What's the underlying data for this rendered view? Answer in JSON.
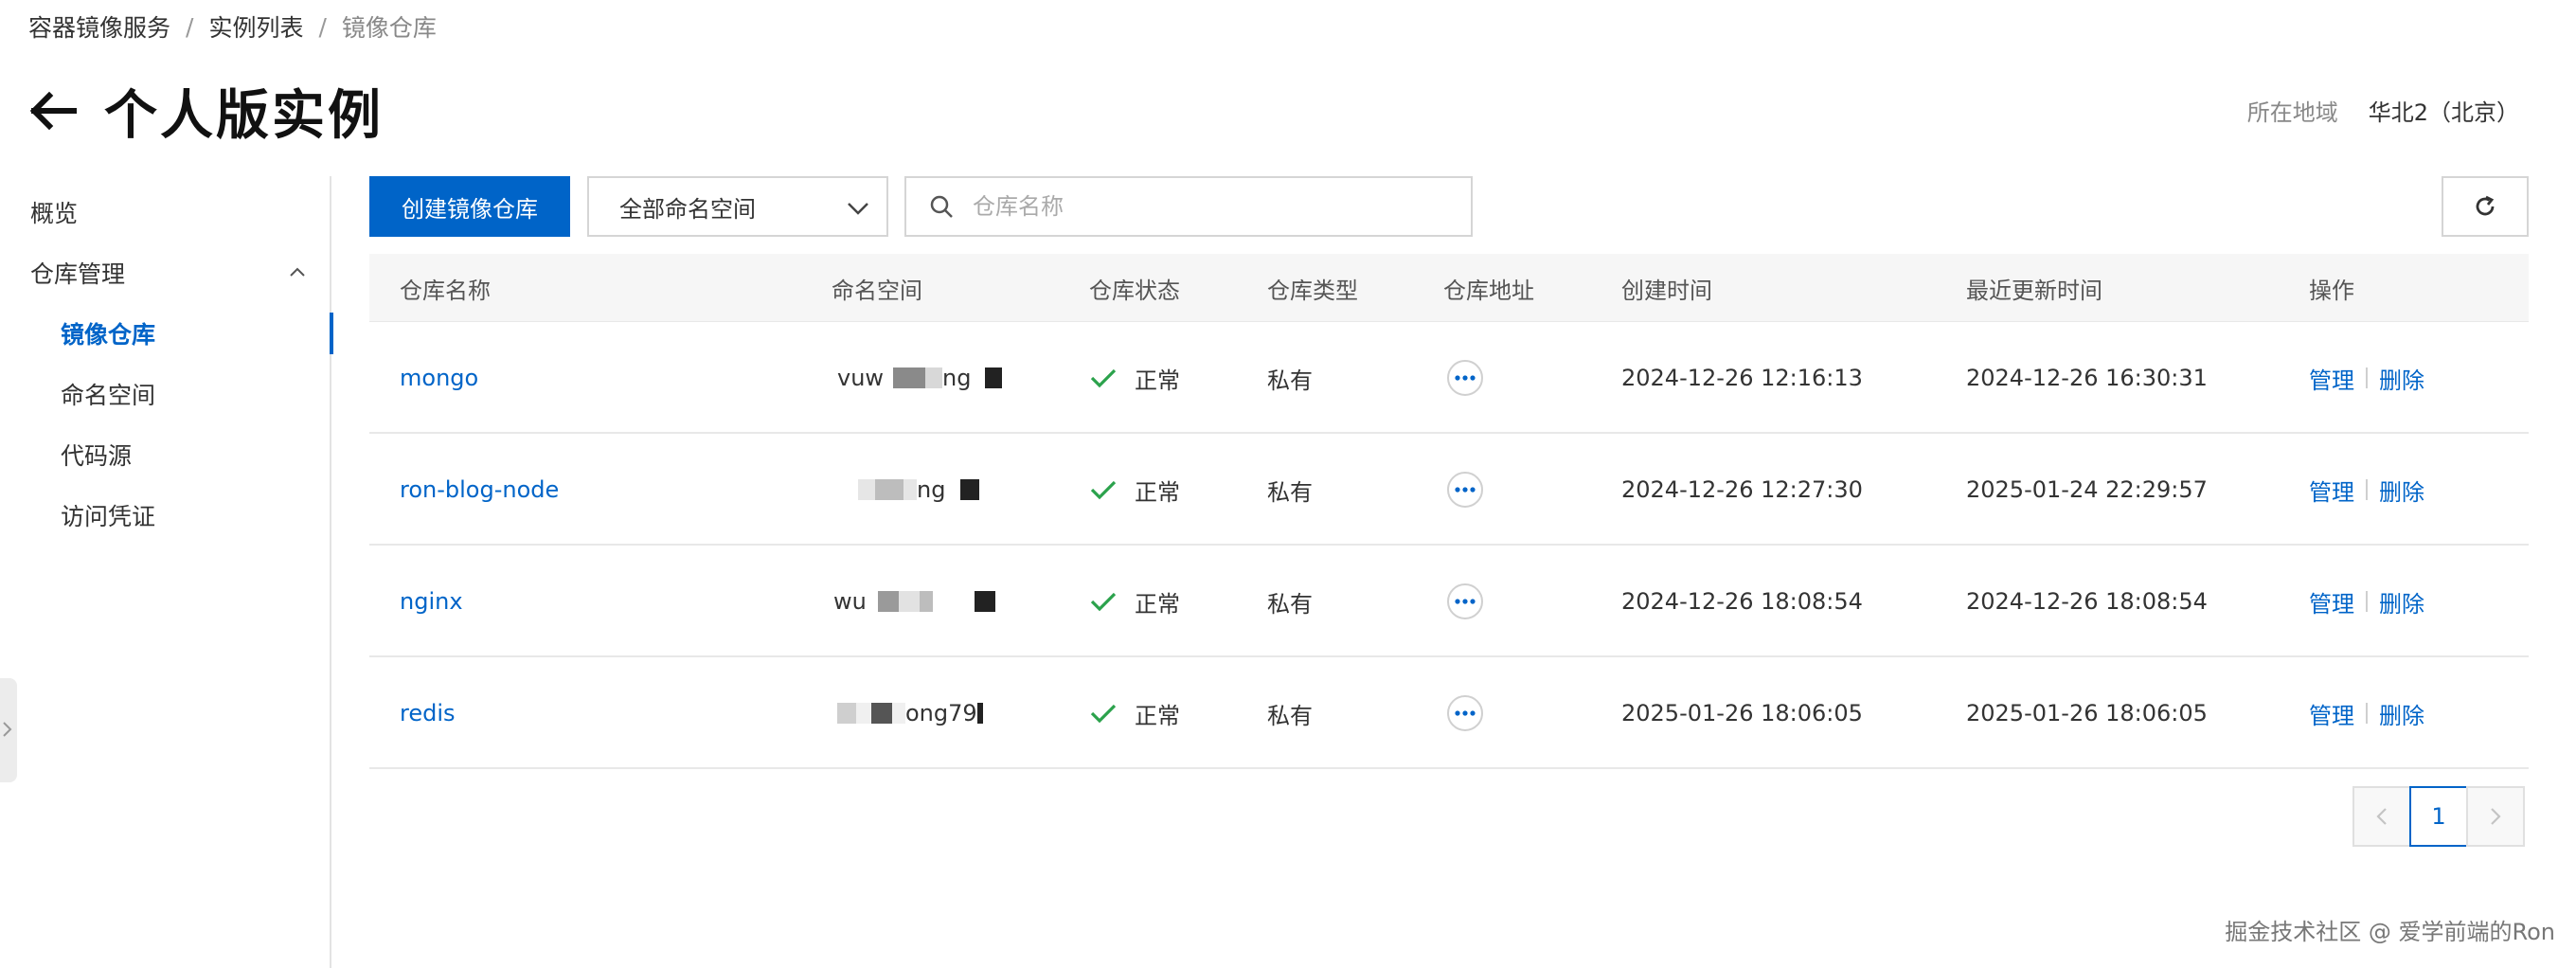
{
  "breadcrumb": {
    "items": [
      "容器镜像服务",
      "实例列表",
      "镜像仓库"
    ],
    "separator": "/"
  },
  "header": {
    "title": "个人版实例",
    "back_icon": "arrow-left-icon"
  },
  "region": {
    "label": "所在地域",
    "value": "华北2（北京）"
  },
  "sidebar": {
    "items": [
      {
        "label": "概览",
        "level": "top"
      },
      {
        "label": "仓库管理",
        "level": "top",
        "expanded": true
      },
      {
        "label": "镜像仓库",
        "level": "sub",
        "active": true
      },
      {
        "label": "命名空间",
        "level": "sub"
      },
      {
        "label": "代码源",
        "level": "sub"
      },
      {
        "label": "访问凭证",
        "level": "sub"
      }
    ]
  },
  "toolbar": {
    "create_label": "创建镜像仓库",
    "namespace_select": "全部命名空间",
    "search_placeholder": "仓库名称",
    "refresh_icon": "refresh-icon"
  },
  "table": {
    "columns": [
      "仓库名称",
      "命名空间",
      "仓库状态",
      "仓库类型",
      "仓库地址",
      "创建时间",
      "最近更新时间",
      "操作"
    ],
    "rows": [
      {
        "name": "mongo",
        "namespace": "vuw",
        "namespace_tail": "ng",
        "status": "正常",
        "type": "私有",
        "created": "2024-12-26 12:16:13",
        "updated": "2024-12-26 16:30:31",
        "op_manage": "管理",
        "op_delete": "删除"
      },
      {
        "name": "ron-blog-node",
        "namespace": "",
        "namespace_tail": "ng",
        "status": "正常",
        "type": "私有",
        "created": "2024-12-26 12:27:30",
        "updated": "2025-01-24 22:29:57",
        "op_manage": "管理",
        "op_delete": "删除"
      },
      {
        "name": "nginx",
        "namespace": "wu",
        "namespace_tail": "",
        "status": "正常",
        "type": "私有",
        "created": "2024-12-26 18:08:54",
        "updated": "2024-12-26 18:08:54",
        "op_manage": "管理",
        "op_delete": "删除"
      },
      {
        "name": "redis",
        "namespace": "",
        "namespace_tail": "ong79",
        "status": "正常",
        "type": "私有",
        "created": "2025-01-26 18:06:05",
        "updated": "2025-01-26 18:06:05",
        "op_manage": "管理",
        "op_delete": "删除"
      }
    ]
  },
  "pagination": {
    "current_page": "1"
  },
  "watermark": "掘金技术社区 @ 爱学前端的Ron",
  "colors": {
    "primary": "#0064c8",
    "status_ok": "#28a745"
  }
}
